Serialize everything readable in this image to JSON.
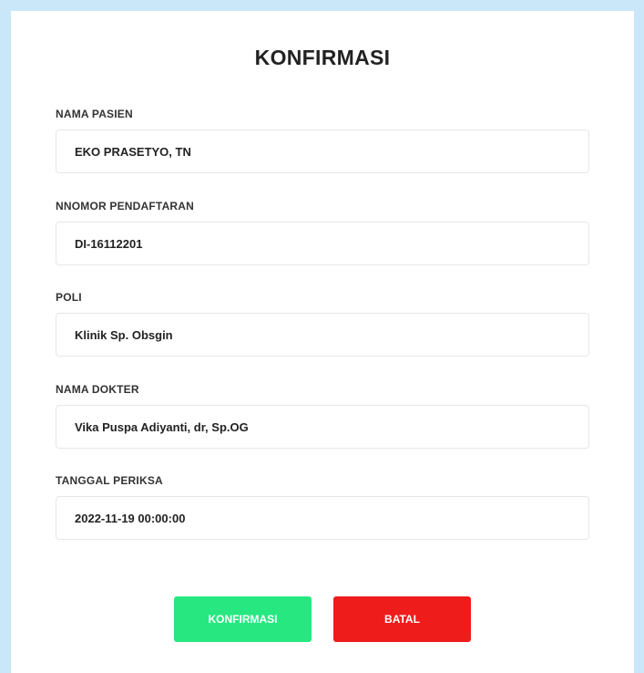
{
  "title": "KONFIRMASI",
  "fields": [
    {
      "label": "NAMA PASIEN",
      "value": "EKO PRASETYO, TN"
    },
    {
      "label": "NNOMOR PENDAFTARAN",
      "value": "DI-16112201"
    },
    {
      "label": "POLI",
      "value": "Klinik Sp. Obsgin"
    },
    {
      "label": "NAMA DOKTER",
      "value": "Vika Puspa Adiyanti, dr, Sp.OG"
    },
    {
      "label": "TANGGAL PERIKSA",
      "value": "2022-11-19 00:00:00"
    }
  ],
  "buttons": {
    "confirm_label": "KONFIRMASI",
    "cancel_label": "BATAL"
  },
  "colors": {
    "page_background": "#c9e7f8",
    "confirm": "#27e880",
    "cancel": "#ef1c1c"
  }
}
